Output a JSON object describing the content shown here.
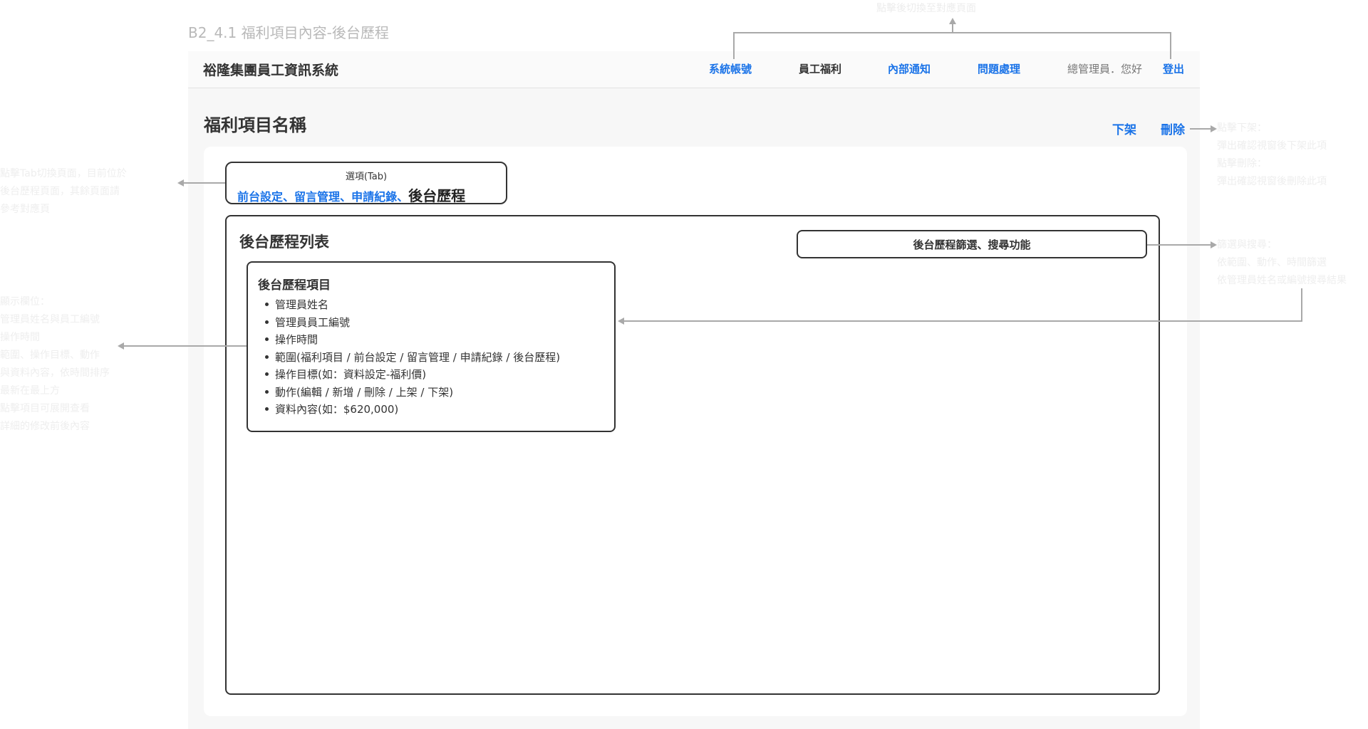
{
  "page_label": "B2_4.1 福利項目內容-後台歷程",
  "top_annotation": "點擊後切換至對應頁面",
  "header": {
    "app_title": "裕隆集團員工資訊系統",
    "nav": {
      "accounts": "系統帳號",
      "benefits": "員工福利",
      "notices": "內部通知",
      "issues": "問題處理"
    },
    "greeting": "總管理員．您好",
    "logout": "登出"
  },
  "page": {
    "title": "福利項目名稱",
    "unpublish": "下架",
    "delete": "刪除"
  },
  "tabs": {
    "caption": "選項(Tab)",
    "items": [
      "前台設定",
      "留言管理",
      "申請紀錄"
    ],
    "separator": "、",
    "active": "後台歷程"
  },
  "history": {
    "list_title": "後台歷程列表",
    "filter_label": "後台歷程篩選、搜尋功能",
    "item": {
      "title": "後台歷程項目",
      "fields": [
        "管理員姓名",
        "管理員員工編號",
        "操作時間",
        "範圍(福利項目 / 前台設定 / 留言管理 / 申請紀錄 / 後台歷程)",
        "操作目標(如：資料設定-福利價)",
        "動作(編輯 / 新增 / 刪除 / 上架 / 下架)",
        "資料內容(如：$620,000)"
      ]
    }
  },
  "annotations": {
    "tabs_note": "點擊Tab切換頁面，目前位於\n後台歷程頁面，其餘頁面請\n參考對應頁",
    "item_note": "顯示欄位：\n管理員姓名與員工編號\n操作時間\n範圍、操作目標、動作\n與資料內容，依時間排序\n最新在最上方\n點擊項目可展開查看\n詳細的修改前後內容",
    "actions_note": "點擊下架：\n彈出確認視窗後下架此項\n點擊刪除：\n彈出確認視窗後刪除此項",
    "filter_note": "篩選與搜尋：\n依範圍、動作、時間篩選\n依管理員姓名或編號搜尋結果"
  }
}
